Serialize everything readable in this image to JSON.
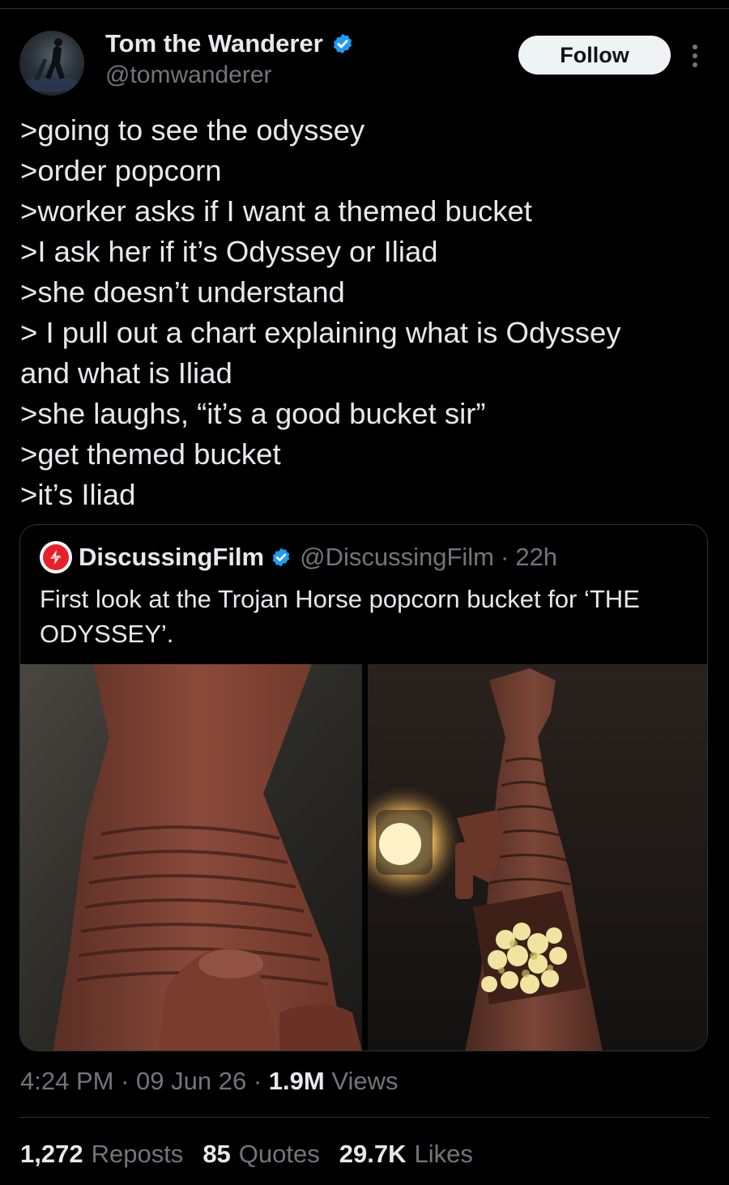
{
  "author": {
    "display_name": "Tom the Wanderer",
    "handle": "@tomwanderer",
    "verified": true,
    "follow_label": "Follow"
  },
  "tweet": {
    "lines": [
      ">going to see the odyssey",
      ">order popcorn",
      ">worker asks if I want a themed bucket",
      ">I ask her if it’s Odyssey or Iliad",
      ">she doesn’t understand",
      "> I pull out a chart explaining what is Odyssey",
      "and what is Iliad",
      ">she laughs, “it’s a good bucket sir”",
      ">get themed bucket",
      ">it’s Iliad"
    ]
  },
  "quote": {
    "display_name": "DiscussingFilm",
    "handle": "@DiscussingFilm",
    "separator": "·",
    "time": "22h",
    "text": "First look at the Trojan Horse popcorn bucket for ‘THE ODYSSEY’.",
    "media": [
      {
        "icon": "trojan-horse-closeup-photo"
      },
      {
        "icon": "trojan-horse-popcorn-bucket-photo"
      }
    ]
  },
  "meta": {
    "time": "4:24 PM",
    "sep1": "·",
    "date": "09 Jun 26",
    "sep2": "·",
    "views_count": "1.9M",
    "views_label": "Views"
  },
  "stats": {
    "reposts_count": "1,272",
    "reposts_label": "Reposts",
    "quotes_count": "85",
    "quotes_label": "Quotes",
    "likes_count": "29.7K",
    "likes_label": "Likes"
  },
  "colors": {
    "background": "#000000",
    "text_primary": "#e7e9ea",
    "text_secondary": "#71767b",
    "verified_blue": "#1d9bf0",
    "border": "#2f3336",
    "follow_bg": "#eff3f4",
    "brand_red": "#e8202a"
  }
}
